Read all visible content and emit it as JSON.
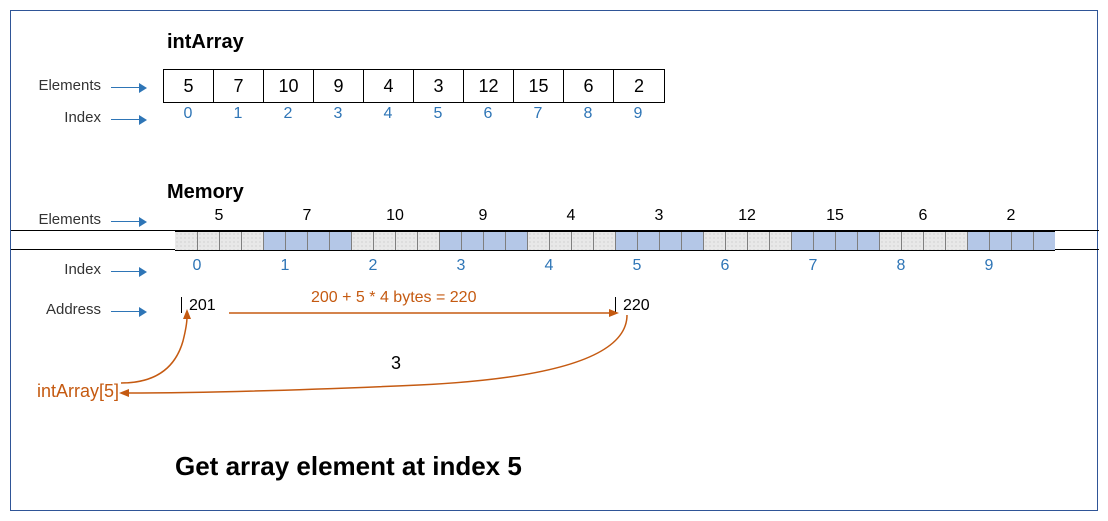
{
  "arrayName": "intArray",
  "labels": {
    "elements": "Elements",
    "index": "Index",
    "memory": "Memory",
    "address": "Address"
  },
  "array": {
    "values": [
      "5",
      "7",
      "10",
      "9",
      "4",
      "3",
      "12",
      "15",
      "6",
      "2"
    ],
    "indices": [
      "0",
      "1",
      "2",
      "3",
      "4",
      "5",
      "6",
      "7",
      "8",
      "9"
    ]
  },
  "memory": {
    "values": [
      "5",
      "7",
      "10",
      "9",
      "4",
      "3",
      "12",
      "15",
      "6",
      "2"
    ],
    "indices": [
      "0",
      "1",
      "2",
      "3",
      "4",
      "5",
      "6",
      "7",
      "8",
      "9"
    ],
    "addr_start": "201",
    "addr_target": "220"
  },
  "formula": "200 + 5 * 4 bytes = 220",
  "lookup_expr": "intArray[5]",
  "lookup_result": "3",
  "caption": "Get array element at index 5",
  "chart_data": {
    "type": "table",
    "title": "Array memory layout and indexed access",
    "array_values": [
      5,
      7,
      10,
      9,
      4,
      3,
      12,
      15,
      6,
      2
    ],
    "indices": [
      0,
      1,
      2,
      3,
      4,
      5,
      6,
      7,
      8,
      9
    ],
    "element_size_bytes": 4,
    "base_address": 200,
    "lookup_index": 5,
    "computed_address": 220,
    "result_value": 3
  }
}
